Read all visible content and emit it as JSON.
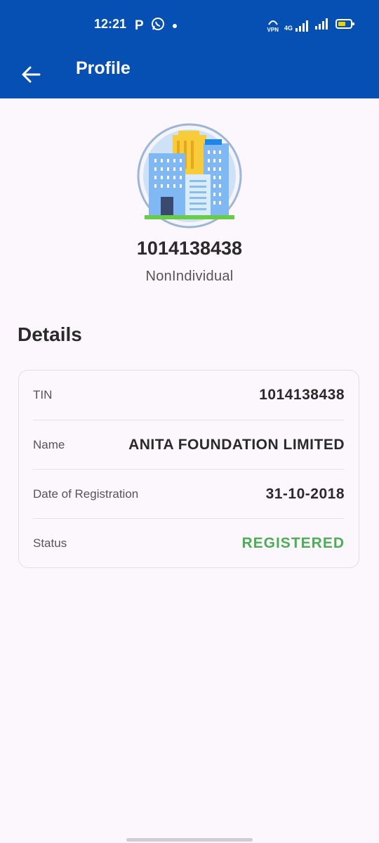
{
  "status_bar": {
    "time": "12:21",
    "notification_icons": [
      "p-icon",
      "whatsapp-icon",
      "dot-icon"
    ],
    "right_icons": [
      "vpn-icon",
      "4g-signal-icon",
      "signal-icon",
      "battery-icon"
    ],
    "network_label": "4G",
    "vpn_label": "VPN"
  },
  "app_bar": {
    "title": "Profile",
    "background_color": "#0650b4"
  },
  "profile": {
    "id": "1014138438",
    "type": "NonIndividual",
    "avatar_icon": "building-icon"
  },
  "details": {
    "heading": "Details",
    "rows": [
      {
        "label": "TIN",
        "value": "1014138438"
      },
      {
        "label": "Name",
        "value": "ANITA FOUNDATION LIMITED"
      },
      {
        "label": "Date of Registration",
        "value": "31-10-2018"
      },
      {
        "label": "Status",
        "value": "REGISTERED",
        "color": "#4cae57"
      }
    ]
  }
}
